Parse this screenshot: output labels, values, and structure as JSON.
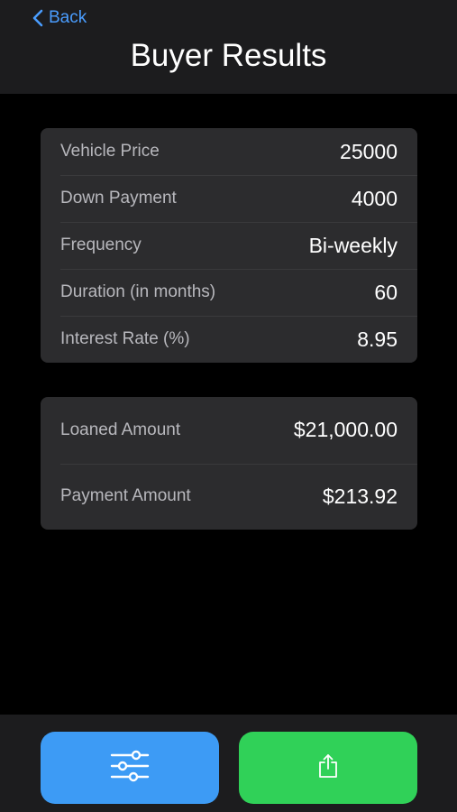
{
  "header": {
    "back_label": "Back",
    "title": "Buyer Results"
  },
  "inputs": [
    {
      "label": "Vehicle Price",
      "value": "25000"
    },
    {
      "label": "Down Payment",
      "value": "4000"
    },
    {
      "label": "Frequency",
      "value": "Bi-weekly"
    },
    {
      "label": "Duration (in months)",
      "value": "60"
    },
    {
      "label": "Interest Rate (%)",
      "value": "8.95"
    }
  ],
  "results": [
    {
      "label": "Loaned Amount",
      "value": "$21,000.00"
    },
    {
      "label": "Payment Amount",
      "value": "$213.92"
    }
  ],
  "toolbar": {
    "filter_icon": "sliders-icon",
    "share_icon": "share-icon",
    "filter_color": "#3d9bf5",
    "share_color": "#30d158"
  },
  "colors": {
    "accent": "#4a9dff",
    "background": "#000000",
    "card": "#2c2c2e"
  }
}
